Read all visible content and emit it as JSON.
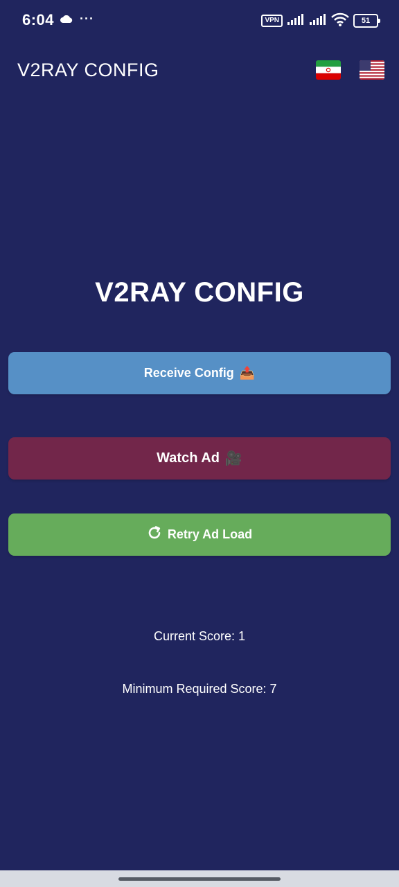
{
  "status_bar": {
    "time": "6:04",
    "vpn_label": "VPN",
    "battery_level": "51",
    "icons": [
      "cloud-icon",
      "more-icon",
      "signal-icon",
      "signal-icon",
      "wifi-icon",
      "battery-icon"
    ]
  },
  "app_bar": {
    "title": "V2RAY CONFIG",
    "flags": [
      "iran-flag",
      "us-flag"
    ]
  },
  "main": {
    "title": "V2RAY CONFIG",
    "receive_button": {
      "label": "Receive Config",
      "icon": "📤"
    },
    "watch_ad_button": {
      "label": "Watch Ad",
      "icon": "🎥"
    },
    "retry_button": {
      "label": "Retry Ad Load",
      "icon": "refresh-icon"
    },
    "current_score_text": "Current Score: 1",
    "minimum_score_text": "Minimum Required Score: 7"
  },
  "colors": {
    "background": "#20255e",
    "receive_button": "#5690c6",
    "watch_ad_button": "#72264a",
    "retry_button": "#66ac5b"
  }
}
